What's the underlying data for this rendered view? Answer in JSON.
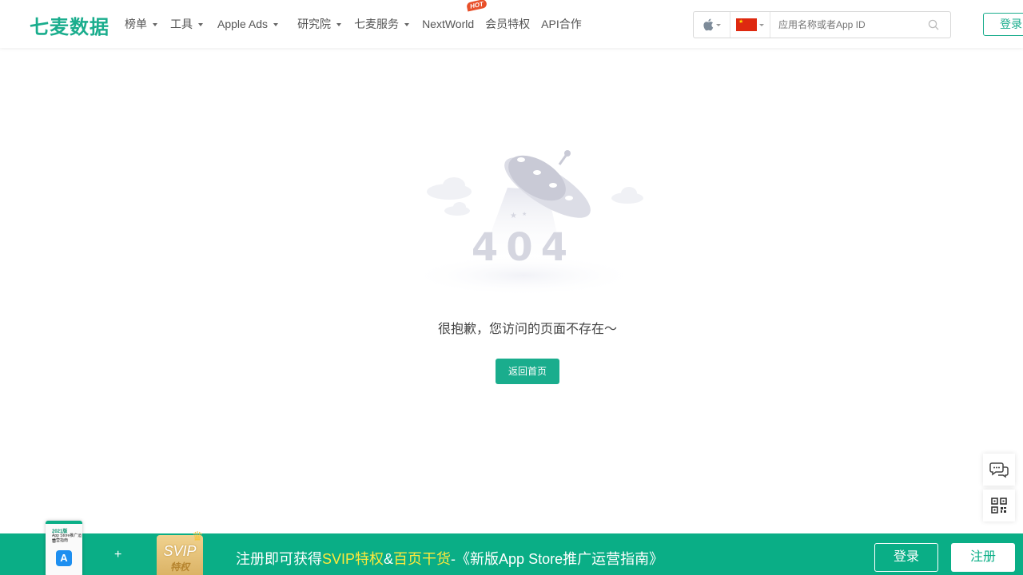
{
  "header": {
    "logo": "七麦数据",
    "nav": [
      {
        "label": "榜单",
        "dropdown": true
      },
      {
        "label": "工具",
        "dropdown": true
      },
      {
        "label": "Apple Ads",
        "dropdown": true
      },
      {
        "label": "研究院",
        "dropdown": true
      },
      {
        "label": "七麦服务",
        "dropdown": true
      },
      {
        "label": "NextWorld",
        "dropdown": false,
        "badge": "HOT"
      },
      {
        "label": "会员特权",
        "dropdown": false
      },
      {
        "label": "API合作",
        "dropdown": false
      }
    ],
    "search": {
      "platform_icon": "apple-icon",
      "country_flag": "china-flag",
      "placeholder": "应用名称或者App ID"
    },
    "login_label": "登录"
  },
  "error_page": {
    "code": "404",
    "message": "很抱歉，您访问的页面不存在～",
    "home_button": "返回首页"
  },
  "side_tools": [
    {
      "icon": "chat-icon"
    },
    {
      "icon": "qrcode-icon"
    }
  ],
  "banner": {
    "book_year": "2021版",
    "book_title": "App Store推广运营",
    "book_subtitle": "运营指南",
    "plus": "+",
    "svip_title": "SVIP",
    "svip_sub": "特权",
    "promo_prefix": "注册即可获得",
    "promo_hl1": "SVIP特权",
    "promo_amp": "&",
    "promo_hl2": "百页干货",
    "promo_suffix": "-《新版App Store推广运营指南》",
    "login_label": "登录",
    "register_label": "注册"
  },
  "colors": {
    "brand": "#1aad8d",
    "banner_bg": "#0aae86",
    "highlight": "#ffe93b",
    "hot": "#e8502a"
  }
}
